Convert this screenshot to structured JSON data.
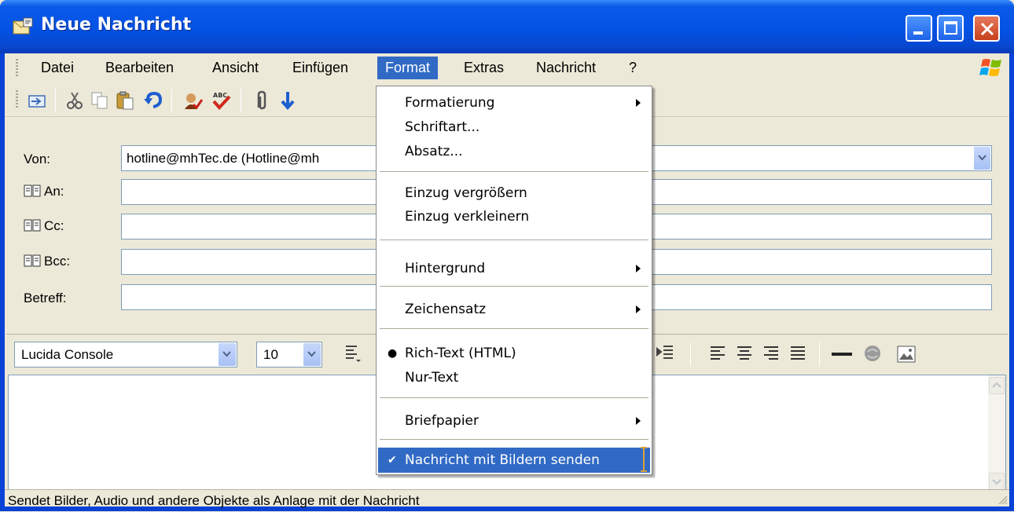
{
  "window": {
    "title": "Neue Nachricht"
  },
  "menubar": {
    "items": [
      "Datei",
      "Bearbeiten",
      "Ansicht",
      "Einfügen",
      "Format",
      "Extras",
      "Nachricht",
      "?"
    ],
    "active": "Format"
  },
  "header": {
    "from_label": "Von:",
    "from_value": "hotline@mhTec.de    (Hotline@mh",
    "to_label": "An:",
    "cc_label": "Cc:",
    "bcc_label": "Bcc:",
    "subject_label": "Betreff:"
  },
  "formatbar": {
    "font": "Lucida Console",
    "size": "10"
  },
  "format_menu": {
    "items": [
      {
        "label": "Formatierung",
        "submenu": true
      },
      {
        "label": "Schriftart..."
      },
      {
        "label": "Absatz..."
      },
      {
        "label": "Einzug vergrößern"
      },
      {
        "label": "Einzug verkleinern"
      },
      {
        "label": "Hintergrund",
        "submenu": true
      },
      {
        "label": "Zeichensatz",
        "submenu": true
      },
      {
        "label": "Rich-Text (HTML)",
        "mark": "radio-dot"
      },
      {
        "label": "Nur-Text"
      },
      {
        "label": "Briefpapier",
        "submenu": true
      },
      {
        "label": "Nachricht mit Bildern senden",
        "mark": "checkmark",
        "highlighted": true
      }
    ]
  },
  "statusbar": {
    "text": "Sendet Bilder, Audio und andere Objekte als Anlage mit der Nachricht"
  },
  "colors": {
    "titlebar": "#0553e6",
    "menu_highlight": "#316ac5",
    "face": "#ece9d8"
  },
  "icons": [
    "send-icon",
    "cut-icon",
    "copy-icon",
    "paste-icon",
    "undo-icon",
    "check-names-icon",
    "spellcheck-icon",
    "attach-icon",
    "address-book-icon",
    "dropdown-chevron-icon",
    "windows-logo-icon"
  ]
}
